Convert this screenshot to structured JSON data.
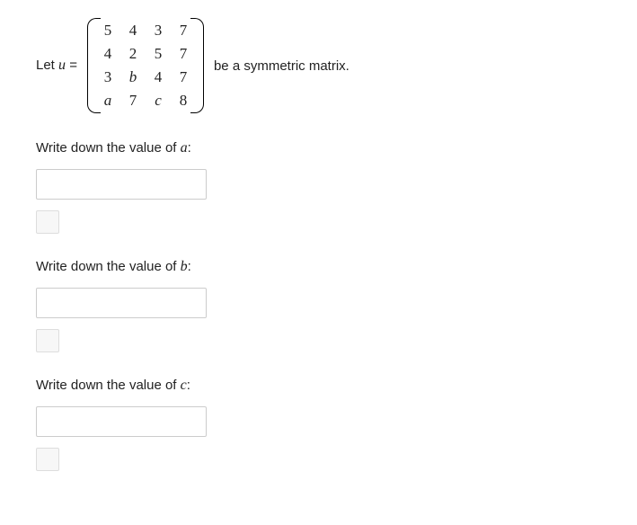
{
  "intro": {
    "prefix": "Let ",
    "var": "u",
    "equals": " = ",
    "suffix": " be a symmetric matrix."
  },
  "matrix": {
    "rows": [
      [
        "5",
        "4",
        "3",
        "7"
      ],
      [
        "4",
        "2",
        "5",
        "7"
      ],
      [
        "3",
        "b",
        "4",
        "7"
      ],
      [
        "a",
        "7",
        "c",
        "8"
      ]
    ],
    "italic_cells": [
      "a",
      "b",
      "c"
    ]
  },
  "prompts": {
    "a": {
      "pre": "Write down the value of ",
      "var": "a",
      "post": ":"
    },
    "b": {
      "pre": "Write down the value of ",
      "var": "b",
      "post": ":"
    },
    "c": {
      "pre": "Write down the value of ",
      "var": "c",
      "post": ":"
    }
  }
}
